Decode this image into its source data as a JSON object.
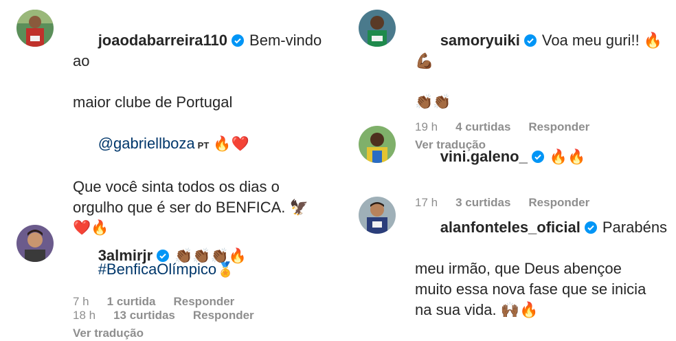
{
  "comments": [
    {
      "username": "joaodabarreira110",
      "lines": [
        "Bem-vindo ao",
        "maior clube de Portugal"
      ],
      "mention": "@gabriellboza",
      "lang_tag": "PT",
      "mention_emojis": "🔥❤️",
      "lines2": [
        "Que você sinta todos os dias o",
        "orgulho que é ser do BENFICA. 🦅",
        "❤️🔥"
      ],
      "hashtag": "#BenficaOlímpico",
      "hashtag_emoji": "🏅",
      "time": "18 h",
      "likes": "13 curtidas",
      "reply": "Responder",
      "translate": "Ver tradução"
    },
    {
      "username": "3almirjr",
      "text": "👏🏾👏🏾👏🏾🔥",
      "time": "7 h",
      "likes": "1 curtida",
      "reply": "Responder"
    },
    {
      "username": "samoryuiki",
      "text": "Voa meu guri!! 🔥💪🏾",
      "text2": "👏🏾👏🏾",
      "time": "19 h",
      "likes": "4 curtidas",
      "reply": "Responder",
      "translate": "Ver tradução"
    },
    {
      "username": "vini.galeno_",
      "text": "🔥🔥",
      "time": "17 h",
      "likes": "3 curtidas",
      "reply": "Responder"
    },
    {
      "username": "alanfonteles_oficial",
      "lines": [
        "Parabéns",
        "meu irmão, que Deus abençoe",
        "muito essa nova fase que se inicia",
        "na sua vida. 🙌🏾🔥"
      ]
    }
  ],
  "colors": {
    "verified": "#0095f6",
    "link": "#00376b",
    "meta": "#8e8e8e",
    "text": "#262626"
  }
}
